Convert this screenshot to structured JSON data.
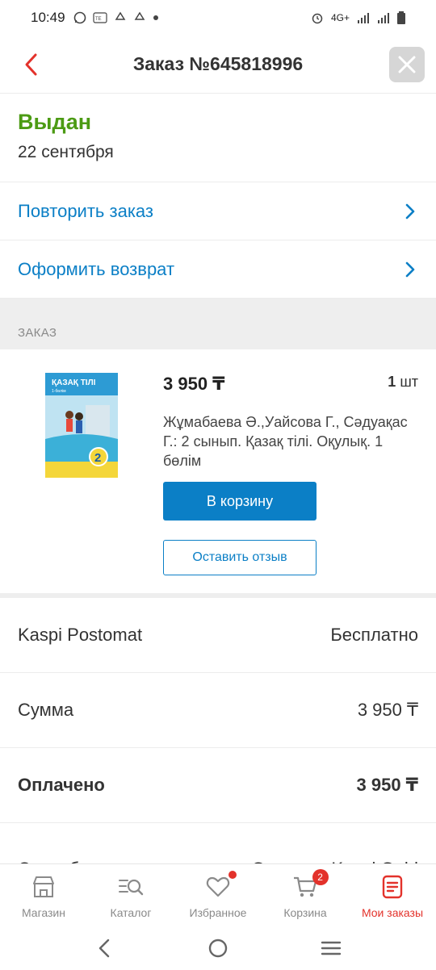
{
  "status_bar": {
    "time": "10:49",
    "notif_icons": [
      "whatsapp-icon",
      "temu-icon",
      "recycle-icon",
      "recycle-icon",
      "dot-icon"
    ],
    "network": "4G+"
  },
  "header": {
    "title": "Заказ №645818996"
  },
  "order_status": {
    "title": "Выдан",
    "date": "22 сентября"
  },
  "actions": [
    {
      "label": "Повторить заказ"
    },
    {
      "label": "Оформить возврат"
    }
  ],
  "section": {
    "label": "ЗАКАЗ"
  },
  "item": {
    "price": "3 950 ₸",
    "qty_num": "1",
    "qty_unit": "шт",
    "title": "Жұмабаева Ә.,Уайсова Г., Сәдуақас Г.: 2 сынып. Қазақ тілі. Оқулық. 1 бөлім",
    "cover": {
      "title": "ҚАЗАҚ ТІЛІ",
      "subtitle": "1-бөлім",
      "grade": "2"
    },
    "cart_label": "В корзину",
    "review_label": "Оставить отзыв"
  },
  "summary": [
    {
      "label": "Kaspi Postomat",
      "value": "Бесплатно"
    },
    {
      "label": "Сумма",
      "value": "3 950 ₸"
    },
    {
      "label": "Оплачено",
      "value": "3 950 ₸"
    },
    {
      "label": "Способ оплаты",
      "value": "Оплата с Kaspi Gold"
    }
  ],
  "bottom_nav": [
    {
      "label": "Магазин",
      "icon": "store-icon"
    },
    {
      "label": "Каталог",
      "icon": "catalog-search-icon"
    },
    {
      "label": "Избранное",
      "icon": "heart-icon"
    },
    {
      "label": "Корзина",
      "icon": "cart-icon",
      "badge": "2"
    },
    {
      "label": "Мои заказы",
      "icon": "orders-icon"
    }
  ],
  "colors": {
    "accent_blue": "#0b7fc6",
    "status_green": "#4c9b14",
    "active_red": "#e3322b"
  }
}
